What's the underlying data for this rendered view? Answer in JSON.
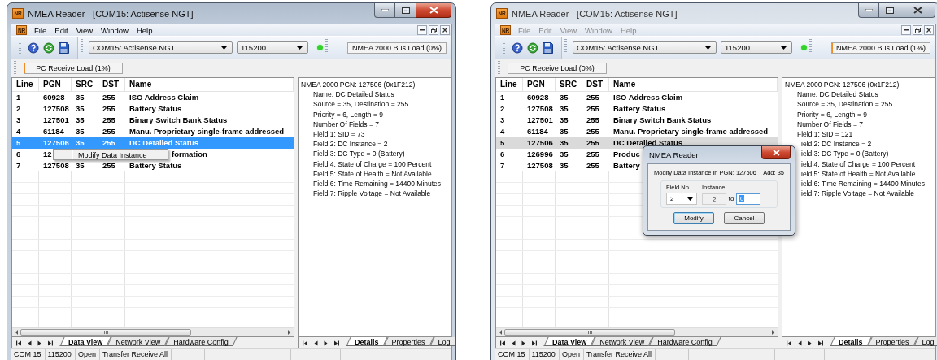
{
  "windows": [
    {
      "active": true,
      "app_icon": "NR",
      "title": "NMEA Reader - [COM15: Actisense NGT]",
      "menu_icon": "NR",
      "menu": [
        {
          "label": "File"
        },
        {
          "label": "Edit"
        },
        {
          "label": "View"
        },
        {
          "label": "Window"
        },
        {
          "label": "Help"
        }
      ],
      "port": "COM15: Actisense NGT",
      "baud": "115200",
      "connected": true,
      "bus_load": {
        "label": "NMEA 2000 Bus Load (0%)",
        "level": 0
      },
      "pc_load": {
        "label": "PC Receive Load (1%)",
        "level": 0.01
      },
      "table": {
        "columns": [
          "Line",
          "PGN",
          "SRC",
          "DST",
          "Name"
        ],
        "rows": [
          {
            "kind": "entry",
            "cells": [
              "1",
              "60928",
              "35",
              "255",
              "ISO Address Claim"
            ],
            "selected": false
          },
          {
            "kind": "entry",
            "cells": [
              "2",
              "127508",
              "35",
              "255",
              "Battery Status"
            ],
            "selected": false
          },
          {
            "kind": "entry",
            "cells": [
              "3",
              "127501",
              "35",
              "255",
              "Binary Switch Bank Status"
            ],
            "selected": false
          },
          {
            "kind": "entry",
            "cells": [
              "4",
              "61184",
              "35",
              "255",
              "Manu. Proprietary single-frame addressed"
            ],
            "selected": false
          },
          {
            "kind": "entry",
            "cells": [
              "5",
              "127506",
              "35",
              "255",
              "DC Detailed Status"
            ],
            "selected": true,
            "context_menu": [
              {
                "label": "Modify Data Instance"
              }
            ]
          },
          {
            "kind": "covered",
            "cells": [
              "6",
              "12",
              "formation"
            ],
            "selected": false
          },
          {
            "kind": "entry",
            "cells": [
              "7",
              "127508",
              "35",
              "255",
              "Battery Status"
            ],
            "selected": false
          }
        ]
      },
      "details": [
        {
          "kind": "heading",
          "text": "NMEA 2000 PGN: 127506 (0x1F212)"
        },
        {
          "kind": "field",
          "text": "Name: DC Detailed Status"
        },
        {
          "kind": "field",
          "text": "Source = 35, Destination = 255"
        },
        {
          "kind": "field",
          "text": "Priority = 6, Length = 9"
        },
        {
          "kind": "field",
          "text": "Number Of Fields = 7"
        },
        {
          "kind": "field",
          "text": "Field 1: SID = 73"
        },
        {
          "kind": "field",
          "text": "Field 2: DC Instance = 2"
        },
        {
          "kind": "field",
          "text": "Field 3: DC Type = 0 (Battery)"
        },
        {
          "kind": "field",
          "text": "Field 4: State of Charge = 100 Percent"
        },
        {
          "kind": "field",
          "text": "Field 5: State of Health = Not Available"
        },
        {
          "kind": "field",
          "text": "Field 6: Time Remaining = 14400 Minutes"
        },
        {
          "kind": "field",
          "text": "Field 7: Ripple Voltage = Not Available"
        }
      ],
      "left_tabs": [
        {
          "label": "Data View",
          "selected": true
        },
        {
          "label": "Network View",
          "selected": false
        },
        {
          "label": "Hardware Config",
          "selected": false
        }
      ],
      "right_tabs": [
        {
          "label": "Details",
          "selected": true
        },
        {
          "label": "Properties",
          "selected": false
        },
        {
          "label": "Log",
          "selected": false
        }
      ],
      "status": [
        "COM 15",
        "115200",
        "Open",
        "Transfer Receive All"
      ]
    },
    {
      "active": false,
      "app_icon": "NR",
      "title": "NMEA Reader - [COM15: Actisense NGT]",
      "menu_icon": "NR",
      "menu": [
        {
          "label": "File"
        },
        {
          "label": "Edit"
        },
        {
          "label": "View"
        },
        {
          "label": "Window"
        },
        {
          "label": "Help"
        }
      ],
      "port": "COM15: Actisense NGT",
      "baud": "115200",
      "connected": true,
      "bus_load": {
        "label": "NMEA 2000 Bus Load (1%)",
        "level": 0.01
      },
      "pc_load": {
        "label": "PC Receive Load (0%)",
        "level": 0
      },
      "table": {
        "columns": [
          "Line",
          "PGN",
          "SRC",
          "DST",
          "Name"
        ],
        "rows": [
          {
            "kind": "entry",
            "cells": [
              "1",
              "60928",
              "35",
              "255",
              "ISO Address Claim"
            ],
            "selected": false
          },
          {
            "kind": "entry",
            "cells": [
              "2",
              "127508",
              "35",
              "255",
              "Battery Status"
            ],
            "selected": false
          },
          {
            "kind": "entry",
            "cells": [
              "3",
              "127501",
              "35",
              "255",
              "Binary Switch Bank Status"
            ],
            "selected": false
          },
          {
            "kind": "entry",
            "cells": [
              "4",
              "61184",
              "35",
              "255",
              "Manu. Proprietary single-frame addressed"
            ],
            "selected": false
          },
          {
            "kind": "entry",
            "cells": [
              "5",
              "127506",
              "35",
              "255",
              "DC Detailed Status"
            ],
            "selected": true
          },
          {
            "kind": "entry",
            "cells": [
              "6",
              "126996",
              "35",
              "255",
              "Produc"
            ],
            "selected": false
          },
          {
            "kind": "entry",
            "cells": [
              "7",
              "127508",
              "35",
              "255",
              "Battery"
            ],
            "selected": false
          }
        ]
      },
      "details": [
        {
          "kind": "heading",
          "text": "NMEA 2000 PGN: 127506 (0x1F212)"
        },
        {
          "kind": "field",
          "text": "Name: DC Detailed Status"
        },
        {
          "kind": "field",
          "text": "Source = 35, Destination = 255"
        },
        {
          "kind": "field",
          "text": "Priority = 6, Length = 9"
        },
        {
          "kind": "field",
          "text": "Number Of Fields = 7"
        },
        {
          "kind": "field",
          "text": "Field 1: SID = 121"
        },
        {
          "kind": "covered",
          "text": "ield 2: DC Instance = 2"
        },
        {
          "kind": "covered",
          "text": "ield 3: DC Type = 0 (Battery)"
        },
        {
          "kind": "covered",
          "text": "ield 4: State of Charge = 100 Percent"
        },
        {
          "kind": "covered",
          "text": "ield 5: State of Health = Not Available"
        },
        {
          "kind": "covered",
          "text": "ield 6: Time Remaining = 14400 Minutes"
        },
        {
          "kind": "covered",
          "text": "ield 7: Ripple Voltage = Not Available"
        }
      ],
      "left_tabs": [
        {
          "label": "Data View",
          "selected": true
        },
        {
          "label": "Network View",
          "selected": false
        },
        {
          "label": "Hardware Config",
          "selected": false
        }
      ],
      "right_tabs": [
        {
          "label": "Details",
          "selected": true
        },
        {
          "label": "Properties",
          "selected": false
        },
        {
          "label": "Log",
          "selected": false
        }
      ],
      "status": [
        "COM 15",
        "115200",
        "Open",
        "Transfer Receive All"
      ],
      "dialog": {
        "title": "NMEA Reader",
        "message": "Modify Data Instance in PGN: 127506",
        "address": "Add: 35",
        "field_label": "Field No.",
        "field_value": "2",
        "instance_label": "Instance",
        "instance_value": "2",
        "to_label": "to",
        "new_value": "0",
        "new_value_selected": true,
        "buttons": [
          {
            "label": "Modify",
            "default": true
          },
          {
            "label": "Cancel",
            "default": false
          }
        ]
      }
    }
  ]
}
